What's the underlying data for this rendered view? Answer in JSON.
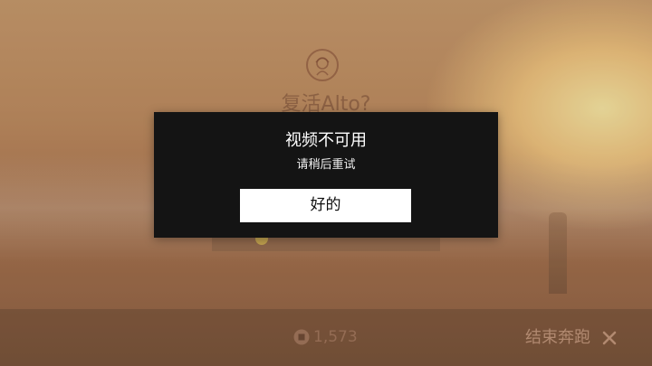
{
  "revive_panel": {
    "title": "复活Alto?"
  },
  "bottom_bar": {
    "coin_count": "1,573",
    "end_run_label": "结束奔跑"
  },
  "dialog": {
    "title": "视频不可用",
    "message": "请稍后重试",
    "ok_label": "好的"
  },
  "icons": {
    "avatar": "character-avatar-icon",
    "coin": "coin-icon",
    "close": "close-icon"
  },
  "colors": {
    "dialog_background": "#141414",
    "dialog_button": "#ffffff",
    "sky_warm": "#c89b6e",
    "sun_glow": "#fbeaa6"
  }
}
